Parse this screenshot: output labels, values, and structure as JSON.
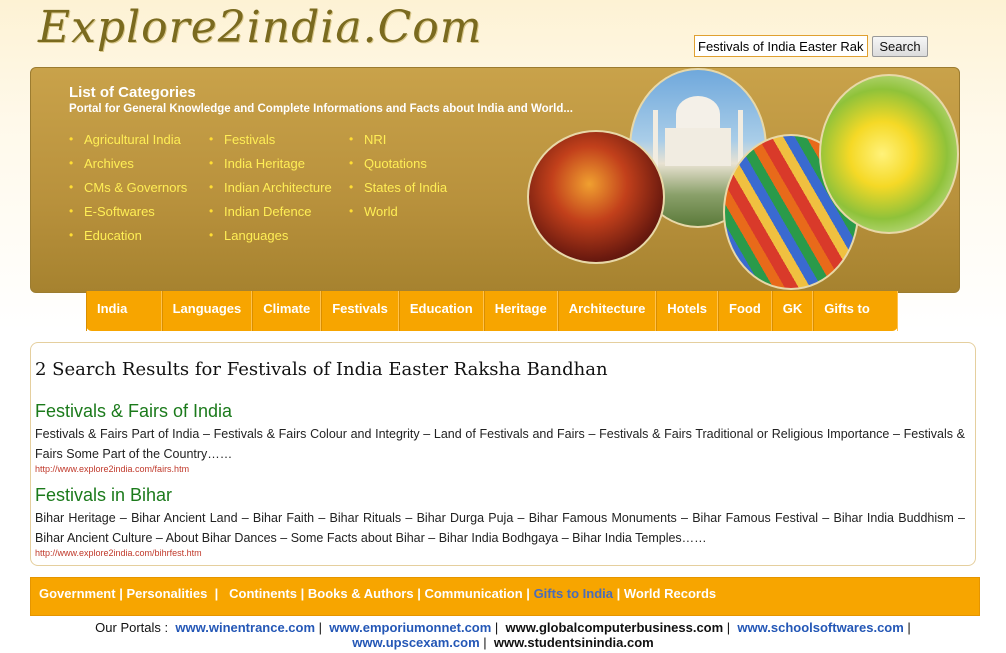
{
  "site": {
    "logo": "Explore2india.Com"
  },
  "search": {
    "value": "Festivals of India Easter Raksha Bandhan",
    "button": "Search"
  },
  "banner": {
    "heading": "List of Categories",
    "subheading": "Portal for General Knowledge and Complete Informations and Facts about India and World...",
    "categories": {
      "col1": [
        "Agricultural India",
        "Archives",
        "CMs & Governors",
        "E-Softwares",
        "Education"
      ],
      "col2": [
        "Festivals",
        "India Heritage",
        "Indian Architecture",
        "Indian Defence",
        "Languages"
      ],
      "col3": [
        "NRI",
        "Quotations",
        "States of India",
        "World"
      ]
    },
    "images": [
      "dance-circle",
      "taj-mahal-circle",
      "pencils-circle",
      "tulips-circle"
    ]
  },
  "nav": [
    "India Facts",
    "Languages",
    "Climate",
    "Festivals",
    "Education",
    "Heritage",
    "Architecture",
    "Hotels",
    "Food",
    "GK",
    "Gifts to India"
  ],
  "results": {
    "title": "2 Search Results for Festivals of India Easter Raksha Bandhan",
    "items": [
      {
        "title": "Festivals & Fairs of India",
        "desc": "Festivals & Fairs Part of India – Festivals & Fairs Colour and Integrity – Land of Festivals and Fairs – Festivals & Fairs Traditional or Religious Importance – Festivals & Fairs Some Part of the Country……",
        "url": "http://www.explore2india.com/fairs.htm"
      },
      {
        "title": "Festivals in Bihar",
        "desc": "Bihar Heritage – Bihar Ancient Land – Bihar Faith – Bihar Rituals – Bihar Durga Puja – Bihar Famous Monuments – Bihar Famous Festival – Bihar India Buddhism – Bihar Ancient Culture – About Bihar Dances – Some Facts about Bihar – Bihar India Bodhgaya – Bihar India Temples……",
        "url": "http://www.explore2india.com/bihrfest.htm"
      }
    ]
  },
  "footer_links": [
    "Government",
    "Personalities",
    "Continents",
    "Books & Authors",
    "Communication",
    "Gifts to India",
    "World Records"
  ],
  "portals": {
    "label": "Our Portals :",
    "links": [
      "www.winentrance.com",
      "www.emporiumonnet.com",
      "www.globalcomputerbusiness.com",
      "www.schoolsoftwares.com",
      "www.upscexam.com",
      "www.studentsinindia.com"
    ]
  },
  "colors": {
    "accent": "#f7a500",
    "banner": "#b8913c",
    "category_text": "#ffee55",
    "result_title": "#1b7a1b",
    "url": "#c0392b",
    "portal_link": "#2457b6"
  }
}
